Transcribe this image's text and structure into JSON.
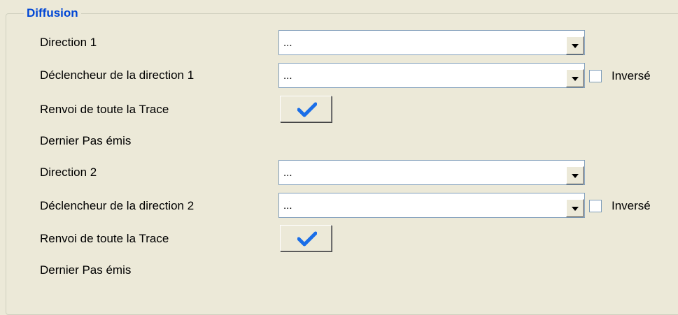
{
  "group": {
    "title": "Diffusion"
  },
  "rows": [
    {
      "label": "Direction 1",
      "combo_value": "..."
    },
    {
      "label": "Déclencheur de la direction 1",
      "combo_value": "...",
      "checkbox_label": "Inversé",
      "checked": false
    },
    {
      "label": "Renvoi de toute la Trace",
      "button_icon": "checkmark-icon"
    },
    {
      "label": "Dernier Pas émis"
    },
    {
      "label": "Direction 2",
      "combo_value": "..."
    },
    {
      "label": "Déclencheur de la direction 2",
      "combo_value": "...",
      "checkbox_label": "Inversé",
      "checked": false
    },
    {
      "label": "Renvoi de toute la Trace",
      "button_icon": "checkmark-icon"
    },
    {
      "label": "Dernier Pas émis"
    }
  ],
  "colors": {
    "legend": "#0046d5",
    "background": "#ece9d8",
    "check": "#1a6ee8"
  }
}
